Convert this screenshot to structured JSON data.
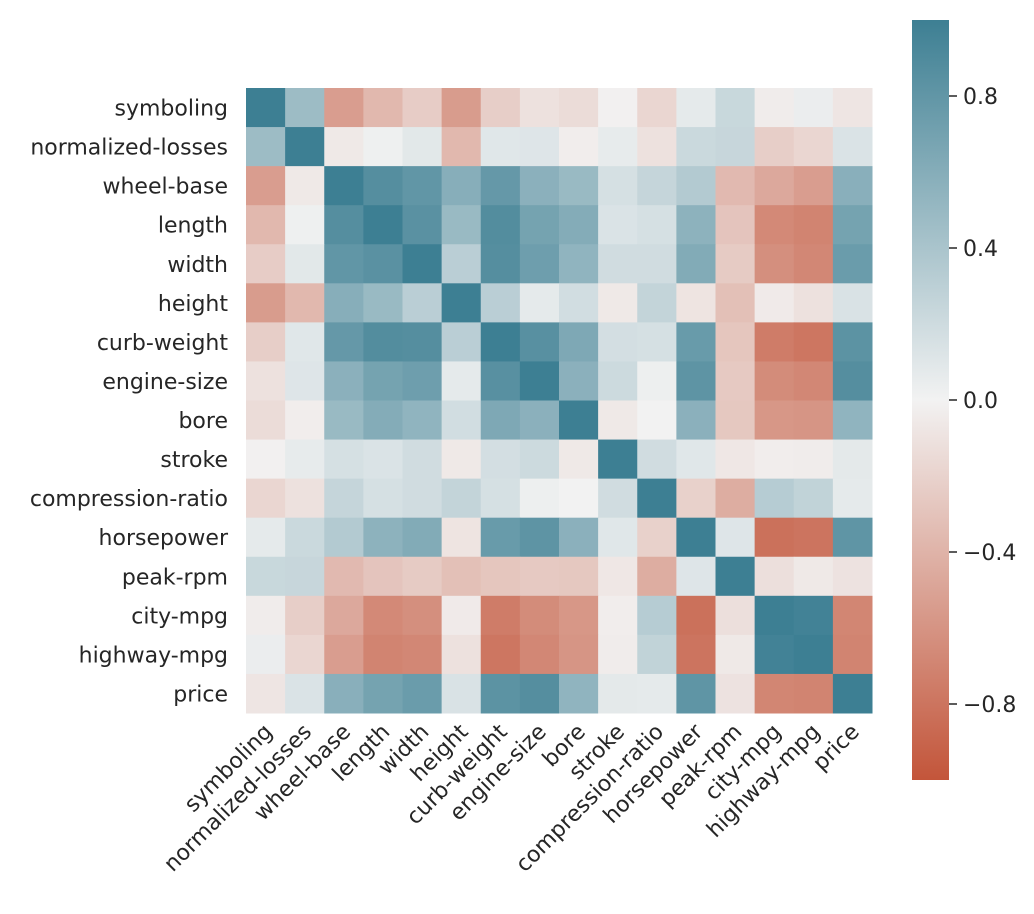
{
  "chart_data": {
    "type": "heatmap",
    "title": "",
    "xlabel": "",
    "ylabel": "",
    "labels": [
      "symboling",
      "normalized-losses",
      "wheel-base",
      "length",
      "width",
      "height",
      "curb-weight",
      "engine-size",
      "bore",
      "stroke",
      "compression-ratio",
      "horsepower",
      "peak-rpm",
      "city-mpg",
      "highway-mpg",
      "price"
    ],
    "matrix": [
      [
        1.0,
        0.47,
        -0.54,
        -0.37,
        -0.24,
        -0.55,
        -0.23,
        -0.11,
        -0.14,
        -0.01,
        -0.18,
        0.07,
        0.23,
        -0.04,
        0.04,
        -0.08
      ],
      [
        0.47,
        1.0,
        -0.06,
        0.02,
        0.09,
        -0.37,
        0.1,
        0.11,
        -0.03,
        0.06,
        -0.11,
        0.22,
        0.24,
        -0.23,
        -0.18,
        0.13
      ],
      [
        -0.54,
        -0.06,
        1.0,
        0.87,
        0.8,
        0.59,
        0.78,
        0.57,
        0.49,
        0.16,
        0.25,
        0.35,
        -0.36,
        -0.47,
        -0.54,
        0.58
      ],
      [
        -0.37,
        0.02,
        0.87,
        1.0,
        0.84,
        0.49,
        0.88,
        0.69,
        0.61,
        0.13,
        0.16,
        0.56,
        -0.29,
        -0.67,
        -0.7,
        0.69
      ],
      [
        -0.24,
        0.09,
        0.8,
        0.84,
        1.0,
        0.31,
        0.87,
        0.73,
        0.54,
        0.19,
        0.19,
        0.62,
        -0.25,
        -0.63,
        -0.68,
        0.75
      ],
      [
        -0.55,
        -0.37,
        0.59,
        0.49,
        0.31,
        1.0,
        0.31,
        0.07,
        0.18,
        -0.06,
        0.26,
        -0.09,
        -0.32,
        -0.05,
        -0.11,
        0.14
      ],
      [
        -0.23,
        0.1,
        0.78,
        0.88,
        0.87,
        0.31,
        1.0,
        0.85,
        0.64,
        0.17,
        0.16,
        0.76,
        -0.28,
        -0.75,
        -0.79,
        0.83
      ],
      [
        -0.11,
        0.11,
        0.57,
        0.69,
        0.73,
        0.07,
        0.85,
        1.0,
        0.57,
        0.21,
        0.03,
        0.82,
        -0.26,
        -0.65,
        -0.68,
        0.87
      ],
      [
        -0.14,
        -0.03,
        0.49,
        0.61,
        0.54,
        0.18,
        0.64,
        0.57,
        1.0,
        -0.06,
        0.0,
        0.57,
        -0.27,
        -0.58,
        -0.59,
        0.54
      ],
      [
        -0.01,
        0.06,
        0.16,
        0.13,
        0.19,
        -0.06,
        0.17,
        0.21,
        -0.06,
        1.0,
        0.19,
        0.1,
        -0.07,
        -0.03,
        -0.04,
        0.08
      ],
      [
        -0.18,
        -0.11,
        0.25,
        0.16,
        0.19,
        0.26,
        0.16,
        0.03,
        0.0,
        0.19,
        1.0,
        -0.21,
        -0.44,
        0.33,
        0.27,
        0.07
      ],
      [
        0.07,
        0.22,
        0.35,
        0.56,
        0.62,
        -0.09,
        0.76,
        0.82,
        0.57,
        0.1,
        -0.21,
        1.0,
        0.11,
        -0.82,
        -0.8,
        0.81
      ],
      [
        0.23,
        0.24,
        -0.36,
        -0.29,
        -0.25,
        -0.32,
        -0.28,
        -0.26,
        -0.27,
        -0.07,
        -0.44,
        0.11,
        1.0,
        -0.12,
        -0.06,
        -0.1
      ],
      [
        -0.04,
        -0.23,
        -0.47,
        -0.67,
        -0.63,
        -0.05,
        -0.75,
        -0.65,
        -0.58,
        -0.03,
        0.33,
        -0.82,
        -0.12,
        1.0,
        0.97,
        -0.69
      ],
      [
        0.04,
        -0.18,
        -0.54,
        -0.7,
        -0.68,
        -0.11,
        -0.79,
        -0.68,
        -0.59,
        -0.04,
        0.27,
        -0.8,
        -0.06,
        0.97,
        1.0,
        -0.7
      ],
      [
        -0.08,
        0.13,
        0.58,
        0.69,
        0.75,
        0.14,
        0.83,
        0.87,
        0.54,
        0.08,
        0.07,
        0.81,
        -0.1,
        -0.69,
        -0.7,
        1.0
      ]
    ],
    "colorbar": {
      "vmin": -1.0,
      "vmax": 1.0,
      "ticks": [
        0.8,
        0.4,
        0.0,
        -0.4,
        -0.8
      ],
      "tick_labels": [
        "0.8",
        "0.4",
        "0.0",
        "−0.4",
        "−0.8"
      ],
      "negative_color": "#c3553a",
      "center_color": "#f2f2f2",
      "positive_color": "#3d7f93"
    },
    "legend": "right"
  }
}
